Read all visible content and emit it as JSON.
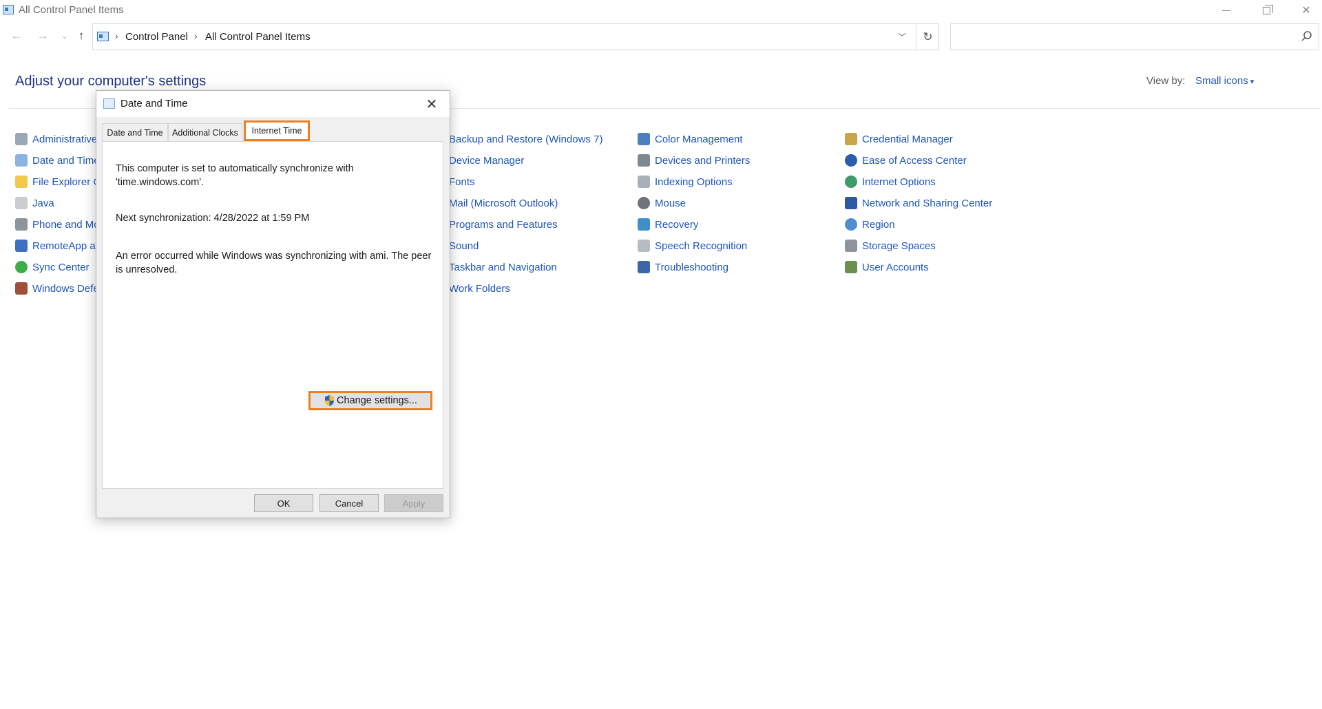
{
  "window": {
    "title": "All Control Panel Items"
  },
  "address": {
    "crumbs": [
      "Control Panel",
      "All Control Panel Items"
    ],
    "search_placeholder": ""
  },
  "header": {
    "heading": "Adjust your computer's settings",
    "view_by_label": "View by:",
    "view_by_value": "Small icons"
  },
  "items": {
    "col1": [
      "Administrative",
      "Date and Time",
      "File Explorer O",
      "Java",
      "Phone and Mo",
      "RemoteApp a",
      "Sync Center",
      "Windows Defe"
    ],
    "col2": [
      "Backup and Restore (Windows 7)",
      "Device Manager",
      "Fonts",
      "Mail (Microsoft Outlook)",
      "Programs and Features",
      "Sound",
      "Taskbar and Navigation",
      "Work Folders"
    ],
    "col3": [
      "Color Management",
      "Devices and Printers",
      "Indexing Options",
      "Mouse",
      "Recovery",
      "Speech Recognition",
      "Troubleshooting"
    ],
    "col4": [
      "Credential Manager",
      "Ease of Access Center",
      "Internet Options",
      "Network and Sharing Center",
      "Region",
      "Storage Spaces",
      "User Accounts"
    ]
  },
  "dialog": {
    "title": "Date and Time",
    "tabs": [
      "Date and Time",
      "Additional Clocks",
      "Internet Time"
    ],
    "sync_text": "This computer is set to automatically synchronize with 'time.windows.com'.",
    "next_sync": "Next synchronization: 4/28/2022 at 1:59 PM",
    "error_text": "An error occurred while Windows was synchronizing with ami.  The peer is unresolved.",
    "change_button": "Change settings...",
    "ok": "OK",
    "cancel": "Cancel",
    "apply": "Apply"
  },
  "colors": {
    "link": "#1e56b4",
    "heading": "#1e3287",
    "highlight": "#f0801e"
  }
}
